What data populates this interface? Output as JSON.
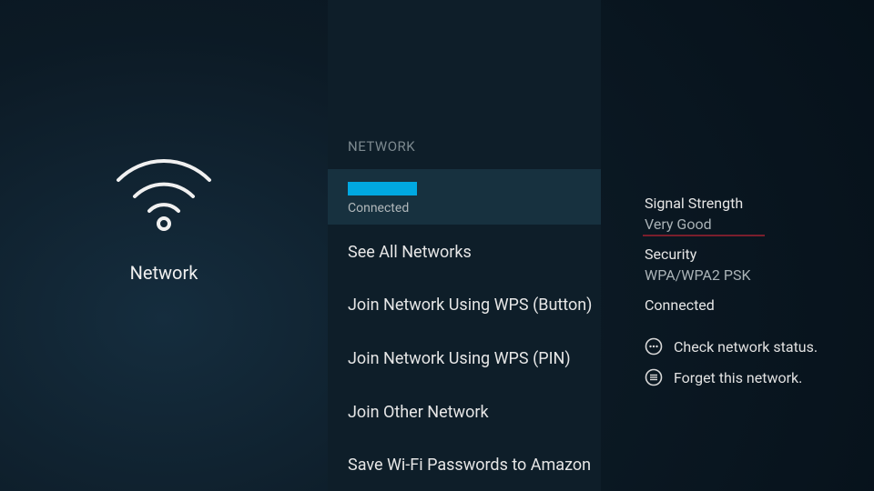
{
  "left": {
    "title": "Network"
  },
  "mid": {
    "header": "NETWORK",
    "current": {
      "status": "Connected"
    },
    "items": [
      {
        "label": "See All Networks"
      },
      {
        "label": "Join Network Using WPS (Button)"
      },
      {
        "label": "Join Network Using WPS (PIN)"
      },
      {
        "label": "Join Other Network"
      },
      {
        "label": "Save Wi-Fi Passwords to Amazon"
      }
    ]
  },
  "detail": {
    "signal_label": "Signal Strength",
    "signal_value": "Very Good",
    "security_label": "Security",
    "security_value": "WPA/WPA2 PSK",
    "status": "Connected",
    "actions": [
      {
        "label": "Check network status."
      },
      {
        "label": "Forget this network."
      }
    ]
  }
}
